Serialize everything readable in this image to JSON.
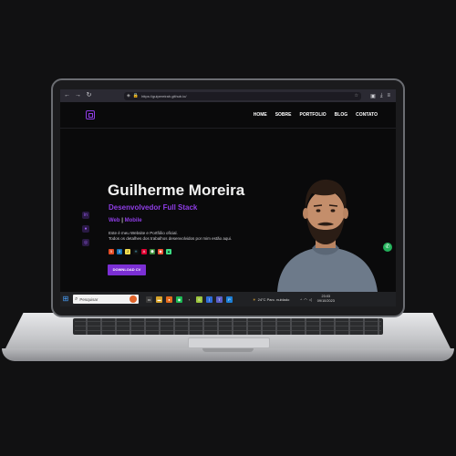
{
  "browser": {
    "url": "https://guipereirah.github.io/",
    "nav": {
      "back": "←",
      "forward": "→",
      "reload": "↻"
    },
    "toolbar_icons": [
      "shield-icon",
      "lock-icon",
      "star-icon",
      "pocket-icon",
      "download-icon",
      "menu-icon"
    ]
  },
  "site": {
    "menu": [
      "HOME",
      "SOBRE",
      "PORTFOLIO",
      "BLOG",
      "CONTATO"
    ]
  },
  "hero": {
    "name": "Guilherme Moreira",
    "role": "Desenvolvedor Full Stack",
    "tag_web": "Web",
    "tag_sep": " | ",
    "tag_mobile": "Mobile",
    "desc_line1": "Este é meu Website e Portfólio oficial.",
    "desc_line2": "Todos os detalhes dos trabalhos desenvolvidos por mim estão aqui.",
    "cv_button": "DOWNLOAD CV",
    "tech_icons": [
      "html-icon",
      "css-icon",
      "js-icon",
      "react-icon",
      "angular-icon",
      "node-icon",
      "git-icon",
      "android-icon"
    ]
  },
  "taskbar": {
    "search_placeholder": "Pesquisar",
    "weather": "24°C  Parc. nublado",
    "time": "23:03",
    "date": "09/10/2023"
  },
  "colors": {
    "accent": "#8f3de6",
    "background": "#0a0a0b",
    "whatsapp": "#22b15a"
  }
}
